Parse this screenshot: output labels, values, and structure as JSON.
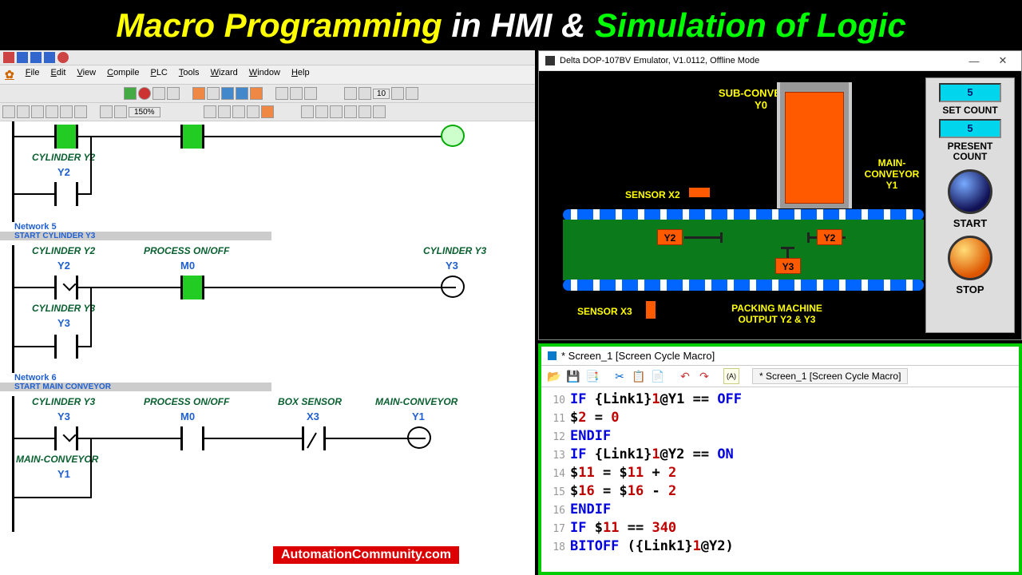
{
  "banner": {
    "p1": "Macro Programming",
    "p2": " in HMI & ",
    "p3": "Simulation of Logic"
  },
  "plc": {
    "menu": [
      "File",
      "Edit",
      "View",
      "Compile",
      "PLC",
      "Tools",
      "Wizard",
      "Window",
      "Help"
    ],
    "zoom": "150%",
    "step": "10",
    "rung1": {
      "c1_label": "CYLINDER Y2",
      "c1_addr": "Y2"
    },
    "net5": {
      "num": "Network 5",
      "title": "START CYLINDER Y3"
    },
    "rung2": {
      "c1_label": "CYLINDER Y2",
      "c1_addr": "Y2",
      "c2_label": "PROCESS ON/OFF",
      "c2_addr": "M0",
      "out_label": "CYLINDER Y3",
      "out_addr": "Y3",
      "hold_label": "CYLINDER Y3",
      "hold_addr": "Y3"
    },
    "net6": {
      "num": "Network 6",
      "title": "START MAIN CONVEYOR"
    },
    "rung3": {
      "c1_label": "CYLINDER Y3",
      "c1_addr": "Y3",
      "c2_label": "PROCESS ON/OFF",
      "c2_addr": "M0",
      "c3_label": "BOX SENSOR",
      "c3_addr": "X3",
      "out_label": "MAIN-CONVEYOR",
      "out_addr": "Y1",
      "hold_label": "MAIN-CONVEYOR",
      "hold_addr": "Y1"
    }
  },
  "hmi": {
    "title": "Delta DOP-107BV Emulator, V1.0112, Offline Mode",
    "sub_conv": "SUB-CONVEYOR\nY0",
    "main_conv": "MAIN-CONVEYOR\nY1",
    "sensor_x2": "SENSOR X2",
    "sensor_x3": "SENSOR X3",
    "pack": "PACKING MACHINE\nOUTPUT Y2 & Y3",
    "y2": "Y2",
    "y3": "Y3",
    "set_count_val": "5",
    "set_count_lbl": "SET COUNT",
    "present_val": "5",
    "present_lbl": "PRESENT COUNT",
    "start": "START",
    "stop": "STOP"
  },
  "macro": {
    "title": "* Screen_1 [Screen Cycle Macro]",
    "tab": "* Screen_1 [Screen Cycle Macro]",
    "lines": [
      {
        "n": "10",
        "t": "IF {Link1}1@Y1 == OFF"
      },
      {
        "n": "11",
        "t": "$2 = 0"
      },
      {
        "n": "12",
        "t": "ENDIF"
      },
      {
        "n": "13",
        "t": "IF {Link1}1@Y2 == ON"
      },
      {
        "n": "14",
        "t": "$11 = $11 + 2"
      },
      {
        "n": "15",
        "t": "$16 = $16 - 2"
      },
      {
        "n": "16",
        "t": "ENDIF"
      },
      {
        "n": "17",
        "t": "IF $11 == 340"
      },
      {
        "n": "18",
        "t": "BITOFF ({Link1}1@Y2)"
      }
    ]
  },
  "watermark": "AutomationCommunity.com"
}
